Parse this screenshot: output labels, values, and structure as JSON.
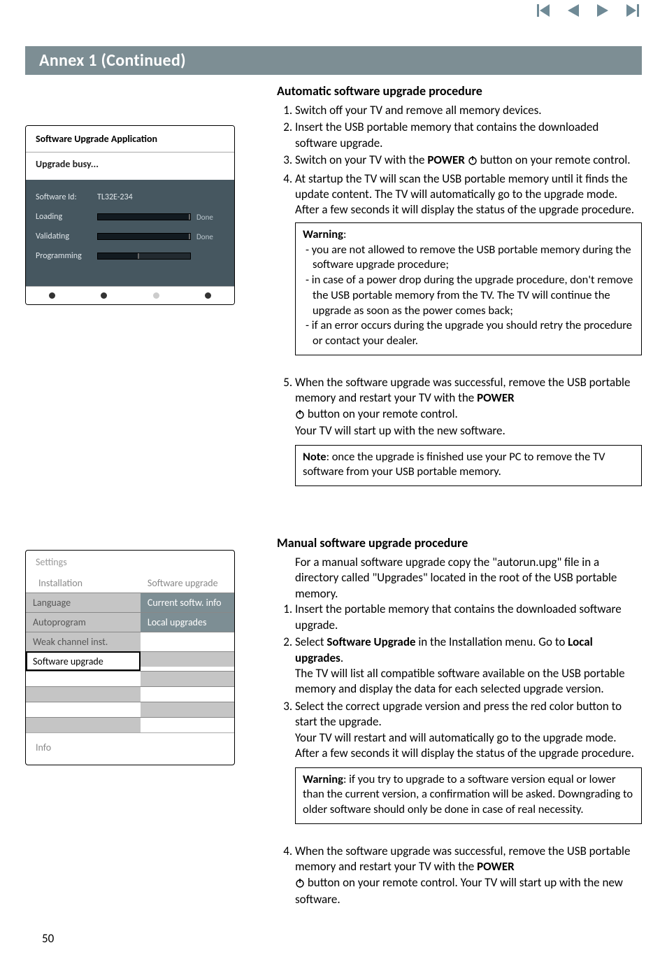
{
  "page_number": "50",
  "header": "Annex 1   (Continued)",
  "app_panel": {
    "title": "Software Upgrade Application",
    "status": "Upgrade busy...",
    "software_id_label": "Software Id:",
    "software_id_value": "TL32E-234",
    "rows": [
      {
        "label": "Loading",
        "done": "Done",
        "fill": 100
      },
      {
        "label": "Validating",
        "done": "Done",
        "fill": 100
      },
      {
        "label": "Programming",
        "done": "",
        "fill": 45
      }
    ]
  },
  "settings_panel": {
    "title": "Settings",
    "col1_head": "Installation",
    "col2_head": "Software upgrade",
    "rows": [
      {
        "c1": "Language",
        "c2": "Current softw. info",
        "c1cls": "grey",
        "c2cls": "sel"
      },
      {
        "c1": "Autoprogram",
        "c2": "Local upgrades",
        "c1cls": "grey",
        "c2cls": "sel"
      },
      {
        "c1": "Weak channel inst.",
        "c2": "",
        "c1cls": "grey",
        "c2cls": "blank2"
      },
      {
        "c1": "Software upgrade",
        "c2": "",
        "c1cls": "hl",
        "c2cls": "blank"
      },
      {
        "c1": "",
        "c2": "",
        "c1cls": "blank2",
        "c2cls": "blank"
      },
      {
        "c1": "",
        "c2": "",
        "c1cls": "blank",
        "c2cls": "blank2"
      },
      {
        "c1": "",
        "c2": "",
        "c1cls": "blank2",
        "c2cls": "blank"
      },
      {
        "c1": "",
        "c2": "",
        "c1cls": "blank",
        "c2cls": "blank2"
      }
    ],
    "info": "Info"
  },
  "auto": {
    "heading": "Automatic software upgrade procedure",
    "li1": "Switch off your TV and remove all memory devices.",
    "li2": "Insert the USB portable memory that contains the downloaded software upgrade.",
    "li3_pre": "Switch on your TV with the ",
    "li3_power": "POWER",
    "li3_post": " button on your remote control.",
    "li4": "At startup the TV will scan the USB portable memory until it finds the update content. The TV will automatically go to the upgrade mode. After a few seconds it will display the status of the upgrade procedure.",
    "warn_head": "Warning",
    "warn_b1": "- you are not allowed to remove the USB portable memory during the software upgrade procedure;",
    "warn_b2": "- in case of a power drop during the upgrade procedure, don't remove the USB portable memory from the TV. The TV will continue the upgrade as soon as the power comes back;",
    "warn_b3": "- if an error occurs during the upgrade you should retry the procedure or contact your dealer.",
    "li5_a": "When the software upgrade was successful, remove the USB portable memory and restart your TV with the ",
    "li5_power": "POWER",
    "li5_b": " button on your remote control.",
    "li5_c": "Your TV will start up with the new software.",
    "note_head": "Note",
    "note_body": ": once the upgrade is finished use your PC to remove the TV software from your USB portable memory."
  },
  "manual": {
    "heading": "Manual software upgrade procedure",
    "intro": "For a manual software upgrade copy the \"autorun.upg\" file in a directory called \"Upgrades\" located in the root of the USB portable memory.",
    "li1": "Insert the portable memory that contains the downloaded software upgrade.",
    "li2_a": "Select ",
    "li2_bold": "Software Upgrade",
    "li2_b": " in the Installation menu. Go to ",
    "li2_bold2": "Local upgrades",
    "li2_body": "The TV will list all compatible software available on the USB portable memory and display the data for each selected upgrade version.",
    "li3_a": "Select the correct upgrade version and press the red color button to start the upgrade.",
    "li3_b": "Your TV will restart and will automatically go to the upgrade mode. After a few seconds it will display the status of the upgrade procedure.",
    "warn_head": "Warning",
    "warn_body": ": if you try to upgrade to a software version equal or lower than the current version, a confirmation will be asked. Downgrading to older software should only be done in case of real necessity.",
    "li4_a": "When the software upgrade was successful, remove the USB portable memory and restart your TV with the ",
    "li4_power": "POWER",
    "li4_b": " button on your remote control. Your TV will start up with the new software."
  }
}
